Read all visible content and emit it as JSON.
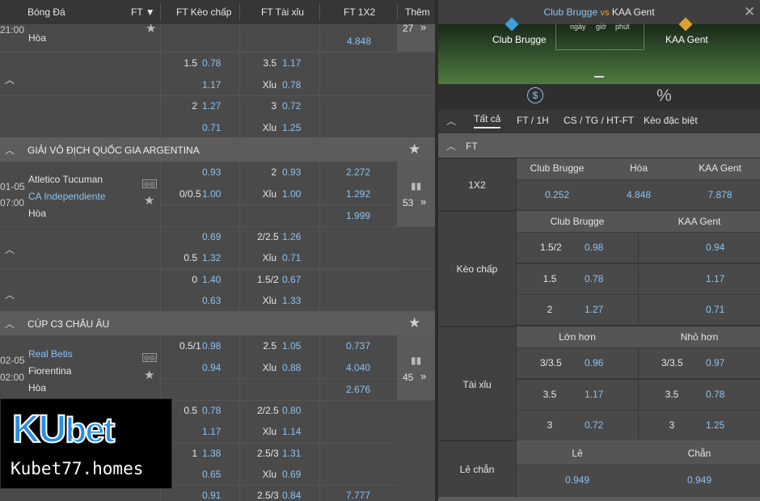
{
  "left_header": {
    "sport": "Bóng Đá",
    "ft": "FT",
    "keo": "FT Kèo chấp",
    "taixiu": "FT Tài xỉu",
    "x12": "FT 1X2",
    "more": "Thêm"
  },
  "top_block": {
    "time": "21:00",
    "draw": "Hòa",
    "x12_draw": "4.848",
    "more_count": "27"
  },
  "top_rows": [
    {
      "h": "1.5",
      "hv": "0.78",
      "t": "3.5",
      "tv": "1.17"
    },
    {
      "h": "",
      "hv": "1.17",
      "t": "Xỉu",
      "tv": "0.78"
    },
    {
      "h": "2",
      "hv": "1.27",
      "t": "3",
      "tv": "0.72"
    },
    {
      "h": "",
      "hv": "0.71",
      "t": "Xỉu",
      "tv": "1.25"
    }
  ],
  "league1": {
    "title": "GIẢI VÔ ĐỊCH QUỐC GIA ARGENTINA"
  },
  "match1": {
    "date": "01-05",
    "time": "07:00",
    "home": "Atletico Tucuman",
    "away": "CA Independiente",
    "draw": "Hòa",
    "more_count": "53",
    "rows": [
      {
        "h": "",
        "hv": "0.93",
        "t": "2",
        "tv": "0.93",
        "x": "2.272"
      },
      {
        "h": "0/0.5",
        "hv": "1.00",
        "t": "Xỉu",
        "tv": "1.00",
        "x": "1.292"
      },
      {
        "h": "",
        "hv": "",
        "t": "",
        "tv": "",
        "x": "1.999"
      }
    ],
    "extra": [
      {
        "h": "",
        "hv": "0.69",
        "t": "2/2.5",
        "tv": "1.26"
      },
      {
        "h": "0.5",
        "hv": "1.32",
        "t": "Xỉu",
        "tv": "0.71"
      },
      {
        "h": "0",
        "hv": "1.40",
        "t": "1.5/2",
        "tv": "0.67"
      },
      {
        "h": "",
        "hv": "0.63",
        "t": "Xỉu",
        "tv": "1.33"
      }
    ]
  },
  "league2": {
    "title": "CÚP C3 CHÂU ÂU"
  },
  "match2": {
    "date": "02-05",
    "time": "02:00",
    "home": "Real Betis",
    "away": "Fiorentina",
    "draw": "Hòa",
    "more_count": "45",
    "rows": [
      {
        "h": "0.5/1",
        "hv": "0.98",
        "t": "2.5",
        "tv": "1.05",
        "x": "0.737"
      },
      {
        "h": "",
        "hv": "0.94",
        "t": "Xỉu",
        "tv": "0.88",
        "x": "4.040"
      },
      {
        "h": "",
        "hv": "",
        "t": "",
        "tv": "",
        "x": "2.676"
      }
    ],
    "extra": [
      {
        "h": "0.5",
        "hv": "0.78",
        "t": "2/2.5",
        "tv": "0.80"
      },
      {
        "h": "",
        "hv": "1.17",
        "t": "Xỉu",
        "tv": "1.14"
      },
      {
        "h": "1",
        "hv": "1.38",
        "t": "2.5/3",
        "tv": "1.31"
      },
      {
        "h": "",
        "hv": "0.65",
        "t": "Xỉu",
        "tv": "0.69"
      },
      {
        "h": "",
        "hv": "0.91",
        "t": "2.5/3",
        "tv": "0.84",
        "x": "7.777"
      }
    ]
  },
  "logo": {
    "ku": "KU",
    "bet": "bet",
    "domain": "Kubet77.homes"
  },
  "right": {
    "home": "Club Brugge",
    "vs": "vs",
    "away": "KAA Gent",
    "pitch_home": "Club Brugge",
    "pitch_away": "KAA Gent",
    "pitch_words": [
      "ngày",
      "giờ",
      "phút"
    ],
    "tabs": [
      "Tất cả",
      "FT / 1H",
      "CS / TG / HT-FT",
      "Kèo đặc biệt"
    ],
    "ft": "FT",
    "x12": {
      "label": "1X2",
      "cols": [
        "Club Brugge",
        "Hòa",
        "KAA Gent"
      ],
      "vals": [
        "0.252",
        "4.848",
        "7.878"
      ]
    },
    "hcap": {
      "label": "Kèo chấp",
      "cols": [
        "Club Brugge",
        "KAA Gent"
      ],
      "rows": [
        {
          "l": "1.5/2",
          "lv": "0.98",
          "rv": "0.94"
        },
        {
          "l": "1.5",
          "lv": "0.78",
          "rv": "1.17"
        },
        {
          "l": "2",
          "lv": "1.27",
          "rv": "0.71"
        }
      ]
    },
    "ou": {
      "label": "Tài xỉu",
      "cols": [
        "Lớn hơn",
        "Nhỏ hơn"
      ],
      "rows": [
        {
          "l": "3/3.5",
          "lv": "0.96",
          "r": "3/3.5",
          "rv": "0.97"
        },
        {
          "l": "3.5",
          "lv": "1.17",
          "r": "3.5",
          "rv": "0.78"
        },
        {
          "l": "3",
          "lv": "0.72",
          "r": "3",
          "rv": "1.25"
        }
      ]
    },
    "oe": {
      "label": "Lẻ chẵn",
      "cols": [
        "Lẻ",
        "Chẵn"
      ],
      "vals": [
        "0.949",
        "0.949"
      ]
    }
  }
}
